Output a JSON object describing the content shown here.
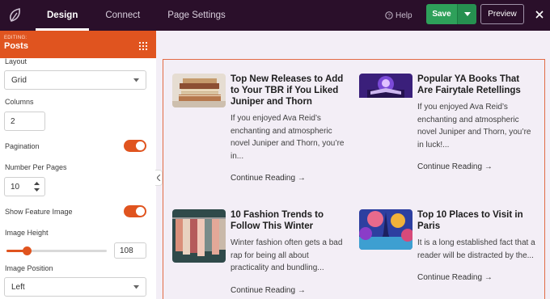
{
  "topbar": {
    "tabs": [
      {
        "label": "Design",
        "active": true
      },
      {
        "label": "Connect",
        "active": false
      },
      {
        "label": "Page Settings",
        "active": false
      }
    ],
    "help_label": "Help",
    "save_label": "Save",
    "preview_label": "Preview"
  },
  "sidebar": {
    "editing_label": "EDITING:",
    "module_title": "Posts",
    "layout": {
      "label": "Layout",
      "value": "Grid"
    },
    "columns": {
      "label": "Columns",
      "value": "2"
    },
    "pagination": {
      "label": "Pagination",
      "on": true
    },
    "per_page": {
      "label": "Number Per Pages",
      "value": "10"
    },
    "show_feature_image": {
      "label": "Show Feature Image",
      "on": true
    },
    "image_height": {
      "label": "Image Height",
      "value": "108",
      "fraction": 0.2
    },
    "image_position": {
      "label": "Image Position",
      "value": "Left"
    }
  },
  "posts": [
    {
      "title": "Top New Releases to Add to Your TBR if You Liked Juniper and Thorn",
      "excerpt": "If you enjoyed Ava Reid’s enchanting and atmospheric novel Juniper and Thorn, you’re in...",
      "more": "Continue Reading →"
    },
    {
      "title": "Popular YA Books That Are Fairytale Retellings",
      "excerpt": "If you enjoyed Ava Reid’s enchanting and atmospheric novel Juniper and Thorn, you’re in luck!...",
      "more": "Continue Reading →"
    },
    {
      "title": "10 Fashion Trends to Follow This Winter",
      "excerpt": "Winter fashion often gets a bad rap for being all about practicality and bundling...",
      "more": "Continue Reading →"
    },
    {
      "title": "Top 10 Places to Visit in Paris",
      "excerpt": "It is a long established fact that a reader will be distracted by the...",
      "more": "Continue Reading →"
    }
  ],
  "colors": {
    "topbar": "#2a0f2a",
    "accent": "#e0541f",
    "save": "#2ea05a"
  }
}
